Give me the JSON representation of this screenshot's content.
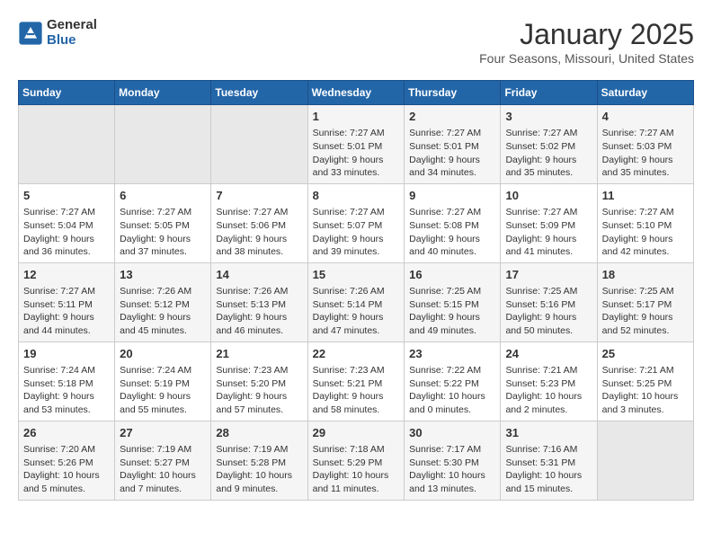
{
  "header": {
    "logo_general": "General",
    "logo_blue": "Blue",
    "title": "January 2025",
    "subtitle": "Four Seasons, Missouri, United States"
  },
  "days_of_week": [
    "Sunday",
    "Monday",
    "Tuesday",
    "Wednesday",
    "Thursday",
    "Friday",
    "Saturday"
  ],
  "weeks": [
    [
      {
        "day": "",
        "content": ""
      },
      {
        "day": "",
        "content": ""
      },
      {
        "day": "",
        "content": ""
      },
      {
        "day": "1",
        "content": "Sunrise: 7:27 AM\nSunset: 5:01 PM\nDaylight: 9 hours\nand 33 minutes."
      },
      {
        "day": "2",
        "content": "Sunrise: 7:27 AM\nSunset: 5:01 PM\nDaylight: 9 hours\nand 34 minutes."
      },
      {
        "day": "3",
        "content": "Sunrise: 7:27 AM\nSunset: 5:02 PM\nDaylight: 9 hours\nand 35 minutes."
      },
      {
        "day": "4",
        "content": "Sunrise: 7:27 AM\nSunset: 5:03 PM\nDaylight: 9 hours\nand 35 minutes."
      }
    ],
    [
      {
        "day": "5",
        "content": "Sunrise: 7:27 AM\nSunset: 5:04 PM\nDaylight: 9 hours\nand 36 minutes."
      },
      {
        "day": "6",
        "content": "Sunrise: 7:27 AM\nSunset: 5:05 PM\nDaylight: 9 hours\nand 37 minutes."
      },
      {
        "day": "7",
        "content": "Sunrise: 7:27 AM\nSunset: 5:06 PM\nDaylight: 9 hours\nand 38 minutes."
      },
      {
        "day": "8",
        "content": "Sunrise: 7:27 AM\nSunset: 5:07 PM\nDaylight: 9 hours\nand 39 minutes."
      },
      {
        "day": "9",
        "content": "Sunrise: 7:27 AM\nSunset: 5:08 PM\nDaylight: 9 hours\nand 40 minutes."
      },
      {
        "day": "10",
        "content": "Sunrise: 7:27 AM\nSunset: 5:09 PM\nDaylight: 9 hours\nand 41 minutes."
      },
      {
        "day": "11",
        "content": "Sunrise: 7:27 AM\nSunset: 5:10 PM\nDaylight: 9 hours\nand 42 minutes."
      }
    ],
    [
      {
        "day": "12",
        "content": "Sunrise: 7:27 AM\nSunset: 5:11 PM\nDaylight: 9 hours\nand 44 minutes."
      },
      {
        "day": "13",
        "content": "Sunrise: 7:26 AM\nSunset: 5:12 PM\nDaylight: 9 hours\nand 45 minutes."
      },
      {
        "day": "14",
        "content": "Sunrise: 7:26 AM\nSunset: 5:13 PM\nDaylight: 9 hours\nand 46 minutes."
      },
      {
        "day": "15",
        "content": "Sunrise: 7:26 AM\nSunset: 5:14 PM\nDaylight: 9 hours\nand 47 minutes."
      },
      {
        "day": "16",
        "content": "Sunrise: 7:25 AM\nSunset: 5:15 PM\nDaylight: 9 hours\nand 49 minutes."
      },
      {
        "day": "17",
        "content": "Sunrise: 7:25 AM\nSunset: 5:16 PM\nDaylight: 9 hours\nand 50 minutes."
      },
      {
        "day": "18",
        "content": "Sunrise: 7:25 AM\nSunset: 5:17 PM\nDaylight: 9 hours\nand 52 minutes."
      }
    ],
    [
      {
        "day": "19",
        "content": "Sunrise: 7:24 AM\nSunset: 5:18 PM\nDaylight: 9 hours\nand 53 minutes."
      },
      {
        "day": "20",
        "content": "Sunrise: 7:24 AM\nSunset: 5:19 PM\nDaylight: 9 hours\nand 55 minutes."
      },
      {
        "day": "21",
        "content": "Sunrise: 7:23 AM\nSunset: 5:20 PM\nDaylight: 9 hours\nand 57 minutes."
      },
      {
        "day": "22",
        "content": "Sunrise: 7:23 AM\nSunset: 5:21 PM\nDaylight: 9 hours\nand 58 minutes."
      },
      {
        "day": "23",
        "content": "Sunrise: 7:22 AM\nSunset: 5:22 PM\nDaylight: 10 hours\nand 0 minutes."
      },
      {
        "day": "24",
        "content": "Sunrise: 7:21 AM\nSunset: 5:23 PM\nDaylight: 10 hours\nand 2 minutes."
      },
      {
        "day": "25",
        "content": "Sunrise: 7:21 AM\nSunset: 5:25 PM\nDaylight: 10 hours\nand 3 minutes."
      }
    ],
    [
      {
        "day": "26",
        "content": "Sunrise: 7:20 AM\nSunset: 5:26 PM\nDaylight: 10 hours\nand 5 minutes."
      },
      {
        "day": "27",
        "content": "Sunrise: 7:19 AM\nSunset: 5:27 PM\nDaylight: 10 hours\nand 7 minutes."
      },
      {
        "day": "28",
        "content": "Sunrise: 7:19 AM\nSunset: 5:28 PM\nDaylight: 10 hours\nand 9 minutes."
      },
      {
        "day": "29",
        "content": "Sunrise: 7:18 AM\nSunset: 5:29 PM\nDaylight: 10 hours\nand 11 minutes."
      },
      {
        "day": "30",
        "content": "Sunrise: 7:17 AM\nSunset: 5:30 PM\nDaylight: 10 hours\nand 13 minutes."
      },
      {
        "day": "31",
        "content": "Sunrise: 7:16 AM\nSunset: 5:31 PM\nDaylight: 10 hours\nand 15 minutes."
      },
      {
        "day": "",
        "content": ""
      }
    ]
  ]
}
